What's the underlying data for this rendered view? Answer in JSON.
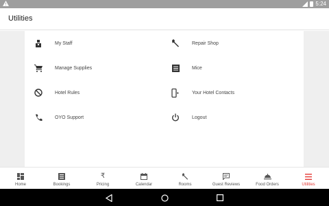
{
  "status_bar": {
    "time": "5:24",
    "icons": [
      "warning-icon",
      "signal-icon",
      "battery-icon"
    ]
  },
  "app_bar": {
    "title": "Utilities"
  },
  "utilities": [
    {
      "label": "My Staff",
      "icon": "staff-icon"
    },
    {
      "label": "Repair Shop",
      "icon": "wrench-icon"
    },
    {
      "label": "Manage Supplies",
      "icon": "cart-icon"
    },
    {
      "label": "Mice",
      "icon": "list-box-icon"
    },
    {
      "label": "Hotel Rules",
      "icon": "block-icon"
    },
    {
      "label": "Your Hotel Contacts",
      "icon": "phone-contact-icon"
    },
    {
      "label": "OYO Support",
      "icon": "phone-icon"
    },
    {
      "label": "Logout",
      "icon": "power-icon"
    }
  ],
  "tabs": [
    {
      "label": "Home",
      "icon": "dashboard-icon",
      "active": false
    },
    {
      "label": "Bookings",
      "icon": "bookings-icon",
      "active": false
    },
    {
      "label": "Pricing",
      "icon": "rupee-icon",
      "glyph": "₹",
      "active": false
    },
    {
      "label": "Calendar",
      "icon": "calendar-icon",
      "active": false
    },
    {
      "label": "Rooms",
      "icon": "wrench-icon",
      "active": false
    },
    {
      "label": "Guest Reviews",
      "icon": "chat-icon",
      "active": false
    },
    {
      "label": "Food Orders",
      "icon": "food-tray-icon",
      "active": false
    },
    {
      "label": "Utilities",
      "icon": "menu-icon",
      "active": true
    }
  ],
  "colors": {
    "accent": "#e53935",
    "status_bar": "#9e9e9e",
    "background": "#efefef",
    "nav_bar": "#000000"
  },
  "nav_bar": {
    "buttons": [
      "back-icon",
      "home-circle-icon",
      "recents-square-icon"
    ]
  }
}
